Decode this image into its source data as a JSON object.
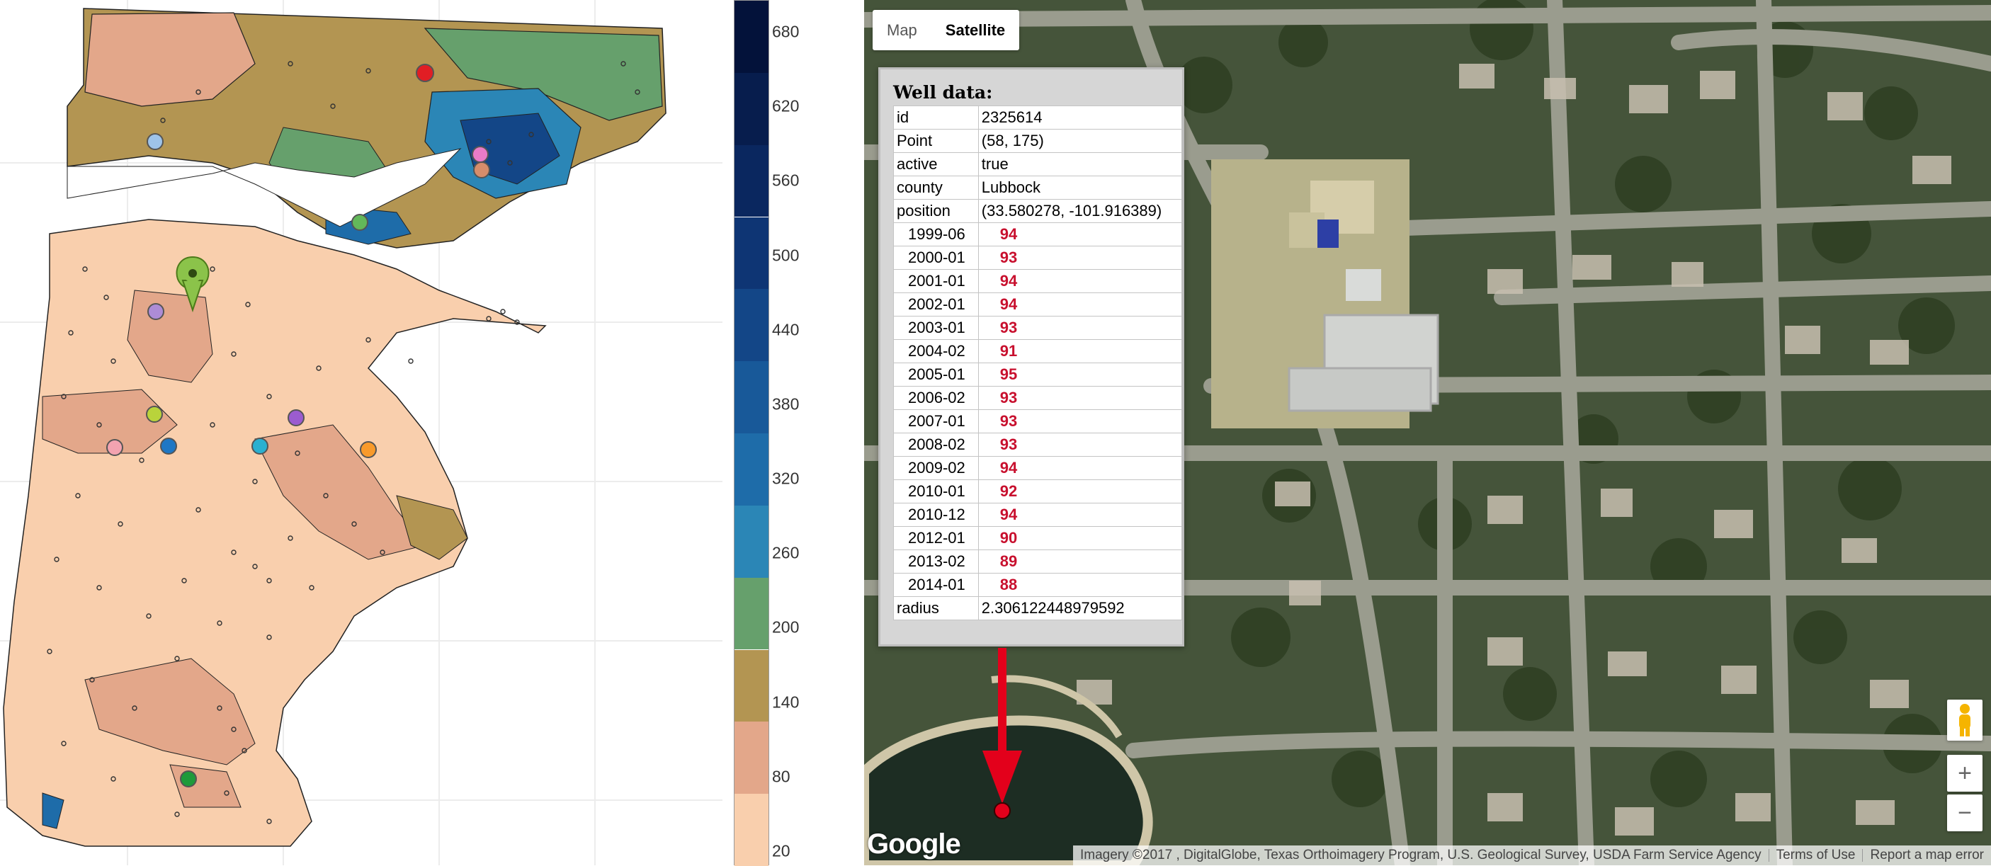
{
  "colorbar": {
    "ticks": [
      "20",
      "80",
      "140",
      "200",
      "260",
      "320",
      "380",
      "440",
      "500",
      "560",
      "620",
      "680"
    ],
    "range": [
      20,
      700
    ],
    "colors": [
      "#f9cfad",
      "#e3a78a",
      "#b39552",
      "#66a06c",
      "#2b86b6",
      "#1e6ca9",
      "#185999",
      "#134687",
      "#0e3574",
      "#0a275f",
      "#071d4d",
      "#03123a"
    ]
  },
  "contour_map": {
    "marker_icon": "map-pin-icon",
    "marker_colors": [
      "#e11e24",
      "#ad8cd6",
      "#63b85a",
      "#e97bc8",
      "#d68d6b",
      "#f89a2b",
      "#1f77c4",
      "#b9d33b",
      "#f3a3b0",
      "#2bb0d0",
      "#9b5ccf",
      "#1e9a3a",
      "#9ec3e9"
    ]
  },
  "satellite": {
    "maptype": {
      "map_label": "Map",
      "satellite_label": "Satellite"
    },
    "infowindow": {
      "title": "Well data:",
      "rows": [
        {
          "key": "id",
          "value": "2325614"
        },
        {
          "key": "Point",
          "value": "(58, 175)"
        },
        {
          "key": "active",
          "value": "true"
        },
        {
          "key": "county",
          "value": "Lubbock"
        },
        {
          "key": "position",
          "value": "(33.580278, -101.916389)"
        }
      ],
      "measurements": [
        {
          "date": "1999-06",
          "value": "94"
        },
        {
          "date": "2000-01",
          "value": "93"
        },
        {
          "date": "2001-01",
          "value": "94"
        },
        {
          "date": "2002-01",
          "value": "94"
        },
        {
          "date": "2003-01",
          "value": "93"
        },
        {
          "date": "2004-02",
          "value": "91"
        },
        {
          "date": "2005-01",
          "value": "95"
        },
        {
          "date": "2006-02",
          "value": "93"
        },
        {
          "date": "2007-01",
          "value": "93"
        },
        {
          "date": "2008-02",
          "value": "93"
        },
        {
          "date": "2009-02",
          "value": "94"
        },
        {
          "date": "2010-01",
          "value": "92"
        },
        {
          "date": "2010-12",
          "value": "94"
        },
        {
          "date": "2012-01",
          "value": "90"
        },
        {
          "date": "2013-02",
          "value": "89"
        },
        {
          "date": "2014-01",
          "value": "88"
        }
      ],
      "footer": {
        "key": "radius",
        "value": "2.306122448979592"
      }
    },
    "zoom_in_label": "+",
    "zoom_out_label": "−",
    "logo": "Google",
    "attribution": {
      "imagery": "Imagery ©2017 , DigitalGlobe, Texas Orthoimagery Program, U.S. Geological Survey, USDA Farm Service Agency",
      "terms": "Terms of Use",
      "report": "Report a map error"
    },
    "arrow_color": "#e3001b",
    "well_marker_color": "#e3001b"
  }
}
